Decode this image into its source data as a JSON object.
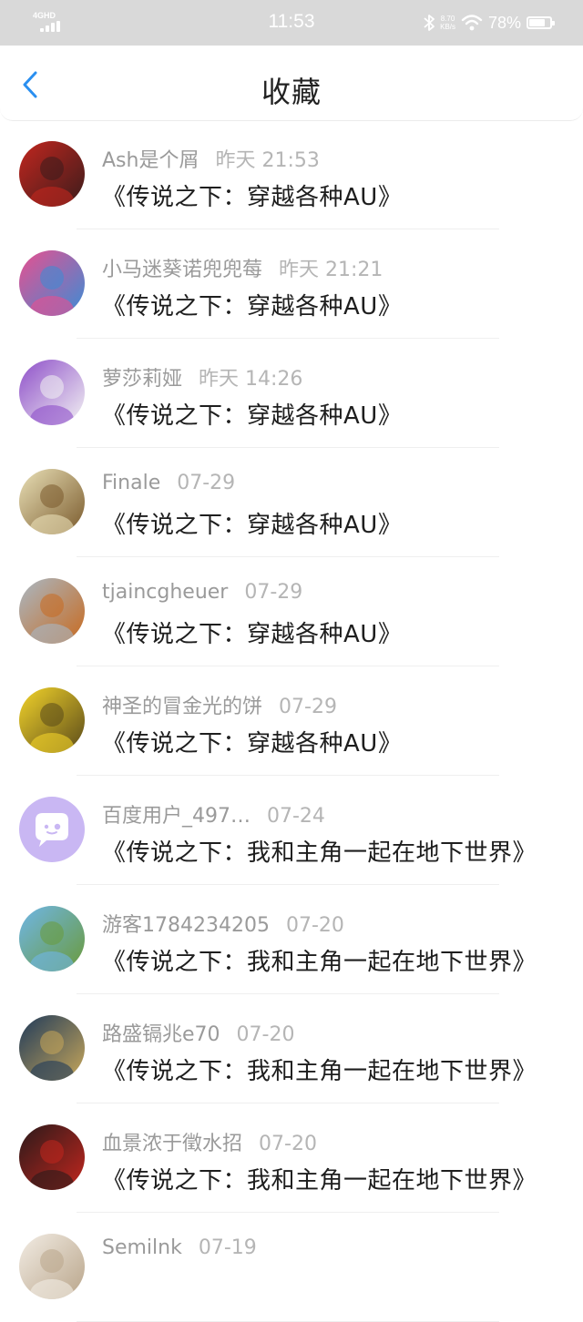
{
  "status_bar": {
    "network": "4GHD",
    "time": "11:53",
    "speed_value": "8.70",
    "speed_unit": "KB/s",
    "battery_percent": "78%",
    "battery_level": 0.78
  },
  "header": {
    "title": "收藏",
    "accent_color": "#2a8ff0"
  },
  "favorites": [
    {
      "user": "Ash是个屑",
      "time": "昨天 21:53",
      "book": "《传说之下：穿越各种AU》",
      "avatar": "red-fox-character-avatar",
      "colors": [
        "#c2261e",
        "#3b1c1c"
      ]
    },
    {
      "user": "小马迷葵诺兜兜莓",
      "time": "昨天 21:21",
      "book": "《传说之下：穿越各种AU》",
      "avatar": "pony-group-avatar",
      "colors": [
        "#e94f8f",
        "#3a8dd6"
      ]
    },
    {
      "user": "萝莎莉娅",
      "time": "昨天 14:26",
      "book": "《传说之下：穿越各种AU》",
      "avatar": "white-goat-purple-cloak-avatar",
      "colors": [
        "#8e4fc9",
        "#f3f3f3"
      ]
    },
    {
      "user": "Finale",
      "time": "07-29",
      "book": "《传说之下：穿越各种AU》",
      "avatar": "anime-character-avatar",
      "colors": [
        "#e9e0b7",
        "#7a5a2c"
      ]
    },
    {
      "user": "tjaincgheuer",
      "time": "07-29",
      "book": "《传说之下：穿越各种AU》",
      "avatar": "tigers-avatar",
      "colors": [
        "#a9b8c4",
        "#c86a1f"
      ]
    },
    {
      "user": "神圣的冒金光的饼",
      "time": "07-29",
      "book": "《传说之下：穿越各种AU》",
      "avatar": "golden-sun-avatar",
      "colors": [
        "#f3d42a",
        "#5a4a1a"
      ]
    },
    {
      "user": "百度用户_497…",
      "time": "07-24",
      "book": "《传说之下：我和主角一起在地下世界》",
      "avatar": "default-chat-bubble-avatar",
      "colors": [
        "#c9b7f3",
        "#ffffff"
      ]
    },
    {
      "user": "游客1784234205",
      "time": "07-20",
      "book": "《传说之下：我和主角一起在地下世界》",
      "avatar": "landscape-sky-avatar",
      "colors": [
        "#6fb6e8",
        "#6a9a3a"
      ]
    },
    {
      "user": "路盛镉兆e70",
      "time": "07-20",
      "book": "《传说之下：我和主角一起在地下世界》",
      "avatar": "night-sky-avatar",
      "colors": [
        "#1f3a5a",
        "#c8a75a"
      ]
    },
    {
      "user": "血景浓于徵水招",
      "time": "07-20",
      "book": "《传说之下：我和主角一起在地下世界》",
      "avatar": "dark-portrait-avatar",
      "colors": [
        "#2a1a1a",
        "#c2261e"
      ]
    },
    {
      "user": "Semilnk",
      "time": "07-19",
      "book": "",
      "avatar": "light-character-avatar",
      "colors": [
        "#f2ece4",
        "#b9a58a"
      ]
    }
  ]
}
